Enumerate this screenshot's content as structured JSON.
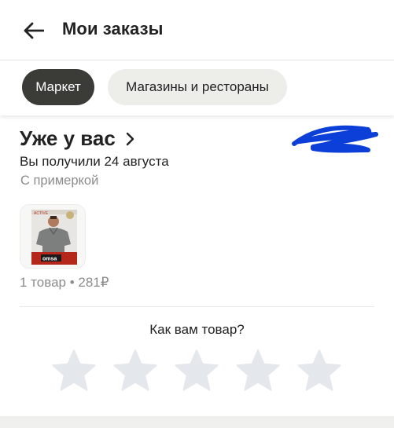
{
  "header": {
    "title": "Мои заказы",
    "back_icon": "arrow-left-icon"
  },
  "tabs": [
    {
      "label": "Маркет",
      "active": true
    },
    {
      "label": "Магазины и рестораны",
      "active": false
    }
  ],
  "order": {
    "status_title": "Уже у вас",
    "received_text": "Вы получили 24 августа",
    "delivery_note": "С примеркой",
    "summary": "1 товар • 281₽",
    "product_image": "product-tshirt-image"
  },
  "rating": {
    "question": "Как вам товар?",
    "stars_count": 5,
    "star_icon": "star-icon"
  },
  "colors": {
    "active_tab_bg": "#3b3b38",
    "inactive_tab_bg": "#ededea",
    "star_empty": "#e4e7ec",
    "scribble": "#0b3fd8"
  }
}
